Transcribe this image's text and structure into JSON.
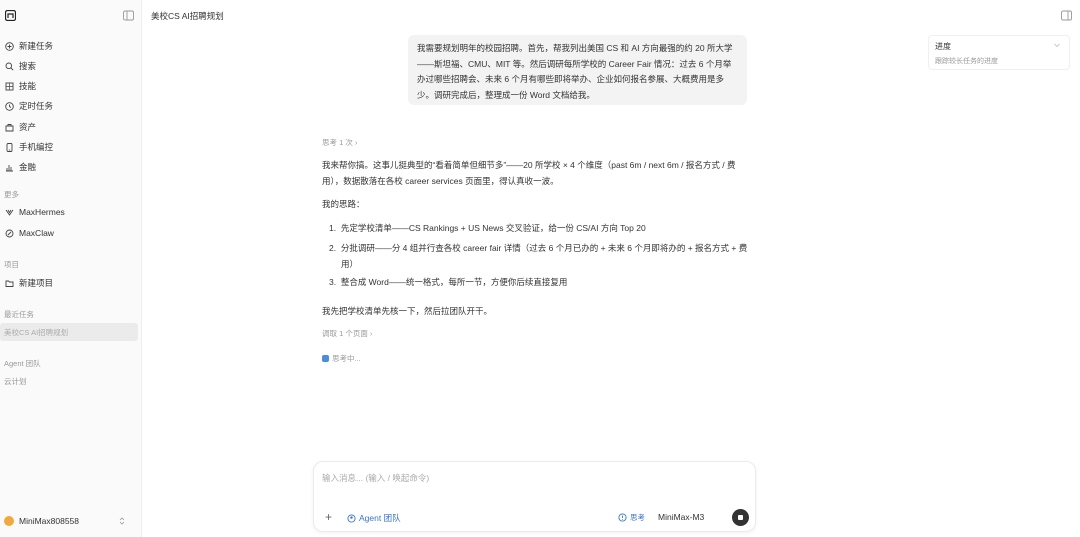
{
  "sidebar": {
    "items": [
      {
        "label": "新建任务",
        "icon": "plus-circle-icon"
      },
      {
        "label": "搜索",
        "icon": "search-icon"
      },
      {
        "label": "技能",
        "icon": "skill-icon"
      },
      {
        "label": "定时任务",
        "icon": "clock-icon"
      },
      {
        "label": "资产",
        "icon": "asset-icon"
      },
      {
        "label": "手机编控",
        "icon": "phone-icon"
      },
      {
        "label": "金融",
        "icon": "chart-icon"
      }
    ],
    "section_agents": "更多",
    "agents": [
      {
        "label": "MaxHermes",
        "icon": "hermes-icon"
      },
      {
        "label": "MaxClaw",
        "icon": "claw-icon"
      }
    ],
    "section_projects": "项目",
    "new_project": "新建项目",
    "section_recent": "最近任务",
    "recent_task": "美校CS AI招聘规划",
    "section_agent_team": "Agent 团队",
    "agent_team_sub": "云计划",
    "user_name": "MiniMax808558"
  },
  "header": {
    "title": "美校CS AI招聘规划"
  },
  "user_message": "我需要规划明年的校园招聘。首先，帮我列出美国 CS 和 AI 方向最强的约 20 所大学——斯坦福、CMU、MIT 等。然后调研每所学校的 Career Fair 情况：过去 6 个月举办过哪些招聘会、未来 6 个月有哪些即将举办、企业如何报名参展、大概费用是多少。调研完成后，整理成一份 Word 文档给我。",
  "assistant": {
    "think_summary": "思考 1 次 ›",
    "intro": "我来帮你搞。这事儿挺典型的“看着简单但细节多”——20 所学校 × 4 个维度（past 6m / next 6m / 报名方式 / 费用），数据散落在各校 career services 页面里，得认真收一波。",
    "plan_title": "我的思路：",
    "plan_items": [
      "先定学校清单——CS Rankings + US News 交叉验证，给一份 CS/AI 方向 Top 20",
      "分批调研——分 4 组并行查各校 career fair 详情（过去 6 个月已办的 + 未来 6 个月即将办的 + 报名方式 + 费用）",
      "整合成 Word——统一格式，每所一节，方便你后续直接复用"
    ],
    "closing": "我先把学校清单先核一下，然后拉团队开干。",
    "execute_summary": "调取 1 个页面 ›",
    "thinking_status": "思考中..."
  },
  "progress": {
    "title": "进度",
    "subtitle": "跟踪较长任务的进度"
  },
  "composer": {
    "placeholder": "输入消息... (输入 / 唤起命令)",
    "agent_team_label": "Agent 团队",
    "think_label": "思考",
    "model": "MiniMax-M3"
  },
  "colors": {
    "accent": "#3a73c9",
    "avatar": "#f2a93b"
  }
}
